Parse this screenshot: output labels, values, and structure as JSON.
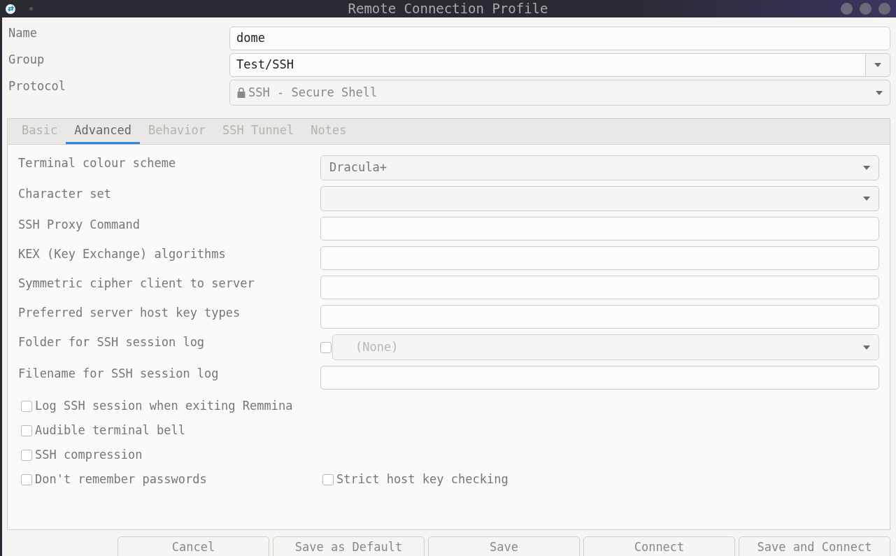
{
  "window": {
    "title": "Remote Connection Profile"
  },
  "profile": [
    {
      "label": "Name",
      "kind": "field",
      "value": "dome"
    },
    {
      "label": "Group",
      "kind": "combo",
      "value": "Test/SSH"
    },
    {
      "label": "Protocol",
      "kind": "select",
      "value": "SSH - Secure Shell"
    }
  ],
  "tabs": [
    {
      "label": "Basic",
      "selected": false
    },
    {
      "label": "Advanced",
      "selected": true
    },
    {
      "label": "Behavior",
      "selected": false
    },
    {
      "label": "SSH Tunnel",
      "selected": false
    },
    {
      "label": "Notes",
      "selected": false
    }
  ],
  "settings": [
    {
      "label": "Terminal colour scheme",
      "kind": "select",
      "value": "Dracula+"
    },
    {
      "label": "Character set",
      "kind": "select"
    },
    {
      "label": "SSH Proxy Command",
      "kind": "field"
    },
    {
      "label": "KEX (Key Exchange) algorithms",
      "kind": "field"
    },
    {
      "label": "Symmetric cipher client to server",
      "kind": "field"
    },
    {
      "label": "Preferred server host key types",
      "kind": "field"
    },
    {
      "label": "Folder for SSH session log",
      "kind": "folder",
      "value": "(None)",
      "checked": false
    },
    {
      "label": "Filename for SSH session log",
      "kind": "field"
    }
  ],
  "options": [
    [
      {
        "label": "Log SSH session when exiting Remmina",
        "checked": false
      }
    ],
    [
      {
        "label": "Audible terminal bell",
        "checked": false
      }
    ],
    [
      {
        "label": "SSH compression",
        "checked": false
      }
    ],
    [
      {
        "label": "Don't remember passwords",
        "checked": false
      },
      {
        "label": "Strict host key checking",
        "checked": false
      }
    ]
  ],
  "buttons": [
    "Cancel",
    "Save as Default",
    "Save",
    "Connect",
    "Save and Connect"
  ]
}
